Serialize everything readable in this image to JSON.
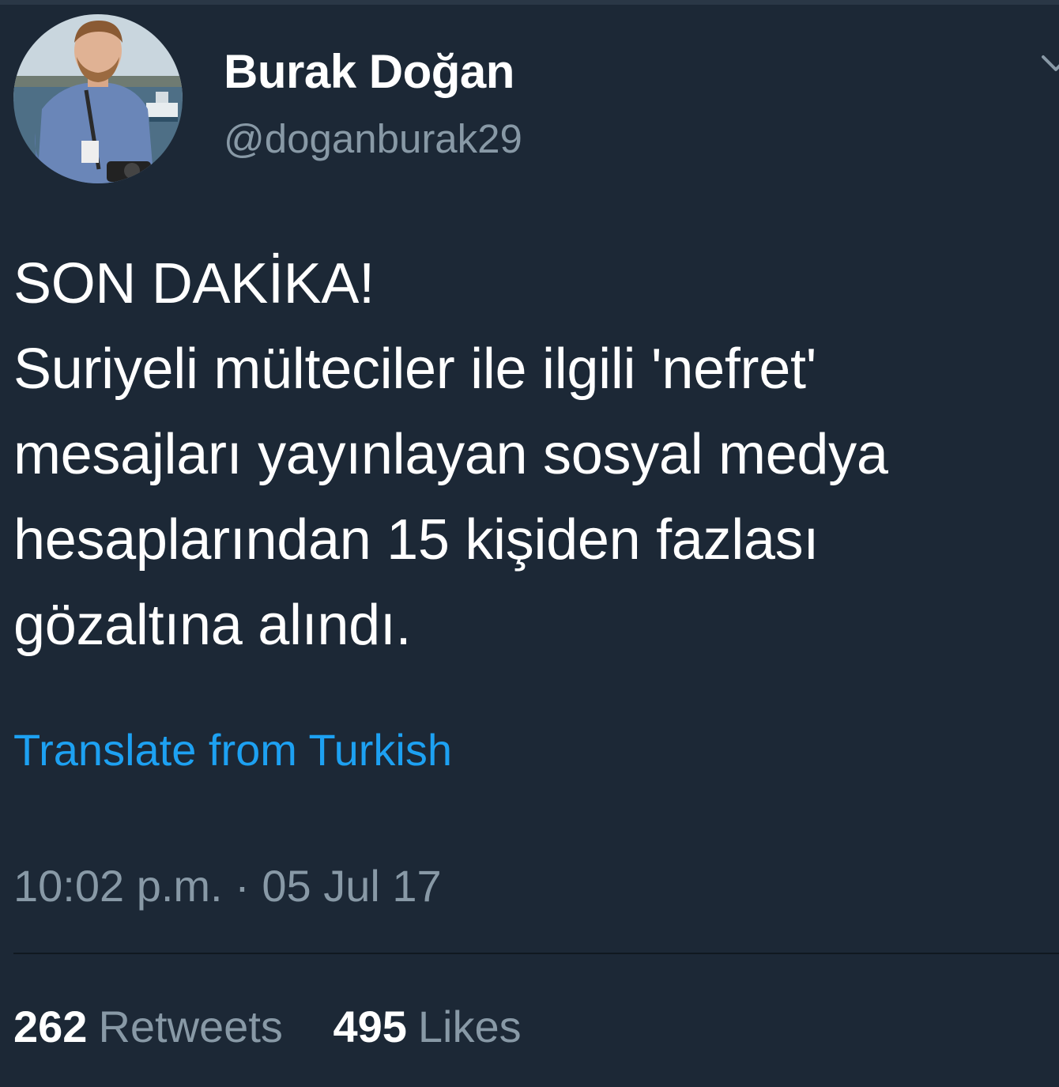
{
  "author": {
    "display_name": "Burak Doğan",
    "handle": "@doganburak29",
    "avatar_icon": "profile-photo-avatar"
  },
  "tweet": {
    "text": "SON DAKİKA!\nSuriyeli mülteciler ile ilgili 'nefret' mesajları yayınlayan sosyal medya hesaplarından 15 kişiden fazlası gözaltına alındı.",
    "translate_label": "Translate from Turkish",
    "timestamp": "10:02 p.m. · 05 Jul 17"
  },
  "stats": {
    "retweets_count": "262",
    "retweets_label": "Retweets",
    "likes_count": "495",
    "likes_label": "Likes"
  },
  "menu_icon": "chevron-down-icon",
  "colors": {
    "background": "#1c2836",
    "link": "#1da1f2",
    "secondary_text": "#8899a6",
    "primary_text": "#ffffff"
  }
}
